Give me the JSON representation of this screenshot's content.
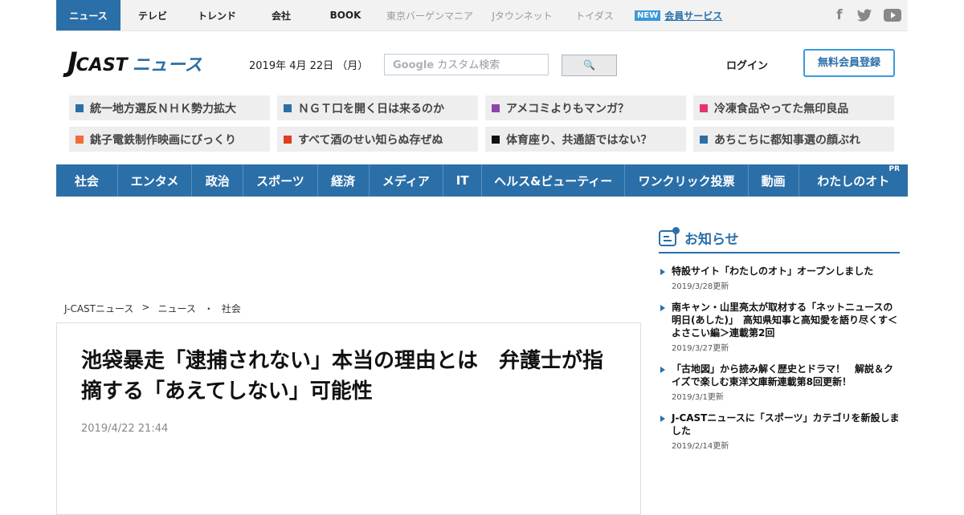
{
  "topbar": {
    "items": [
      {
        "label": "ニュース"
      },
      {
        "label": "テレビ"
      },
      {
        "label": "トレンド"
      },
      {
        "label": "会社"
      },
      {
        "label": "BOOK"
      },
      {
        "label": "東京バーゲンマニア"
      },
      {
        "label": "Jタウンネット"
      },
      {
        "label": "トイダス"
      }
    ],
    "new_badge": "NEW",
    "member_service": "会員サービス",
    "social": {
      "facebook": "f"
    }
  },
  "header": {
    "logo_j": "J",
    "logo_cast": "CAST",
    "logo_news": "ニュース",
    "date": "2019年 4月 22日 （月）",
    "search_google": "Google",
    "search_placeholder": "カスタム検索",
    "search_button": "🔍",
    "login": "ログイン",
    "register": "無料会員登録"
  },
  "topics": [
    {
      "label": "統一地方選反ＮＨＫ勢力拡大",
      "color": "#2b6fa8"
    },
    {
      "label": "ＮＧＴ口を開く日は来るのか",
      "color": "#2b6fa8"
    },
    {
      "label": "アメコミよりもマンガ？",
      "color": "#8e44ad"
    },
    {
      "label": "冷凍食品やってた無印良品",
      "color": "#e8326e"
    },
    {
      "label": "銚子電鉄制作映画にびっくり",
      "color": "#f26b3a"
    },
    {
      "label": "すべて酒のせい知らぬ存ぜぬ",
      "color": "#e03c1f"
    },
    {
      "label": "体育座り、共通語ではない？",
      "color": "#111111"
    },
    {
      "label": "あちこちに都知事選の顔ぶれ",
      "color": "#2b6fa8"
    }
  ],
  "nav": [
    {
      "label": "社会"
    },
    {
      "label": "エンタメ"
    },
    {
      "label": "政治"
    },
    {
      "label": "スポーツ"
    },
    {
      "label": "経済"
    },
    {
      "label": "メディア"
    },
    {
      "label": "IT"
    },
    {
      "label": "ヘルス&ビューティー"
    },
    {
      "label": "ワンクリック投票"
    },
    {
      "label": "動画"
    },
    {
      "label": "わたしのオト",
      "pr": "PR"
    }
  ],
  "breadcrumb": [
    "J-CASTニュース",
    ">",
    "ニュース",
    "・",
    "社会"
  ],
  "article": {
    "title": "池袋暴走「逮捕されない」本当の理由とは　弁護士が指摘する「あえてしない」可能性",
    "time": "2019/4/22 21:44"
  },
  "sidebar": {
    "title": "お知らせ",
    "items": [
      {
        "title": "特設サイト「わたしのオト」オープンしました",
        "date": "2019/3/28更新"
      },
      {
        "title": "南キャン・山里亮太が取材する「ネットニュースの明日(あした)」　高知県知事と高知愛を語り尽くす＜よさこい編＞連載第2回",
        "date": "2019/3/27更新"
      },
      {
        "title": "「古地図」から読み解く歴史とドラマ！　解説＆クイズで楽しむ東洋文庫新連載第8回更新！",
        "date": "2019/3/1更新"
      },
      {
        "title": "J-CASTニュースに「スポーツ」カテゴリを新設しました",
        "date": "2019/2/14更新"
      }
    ]
  }
}
